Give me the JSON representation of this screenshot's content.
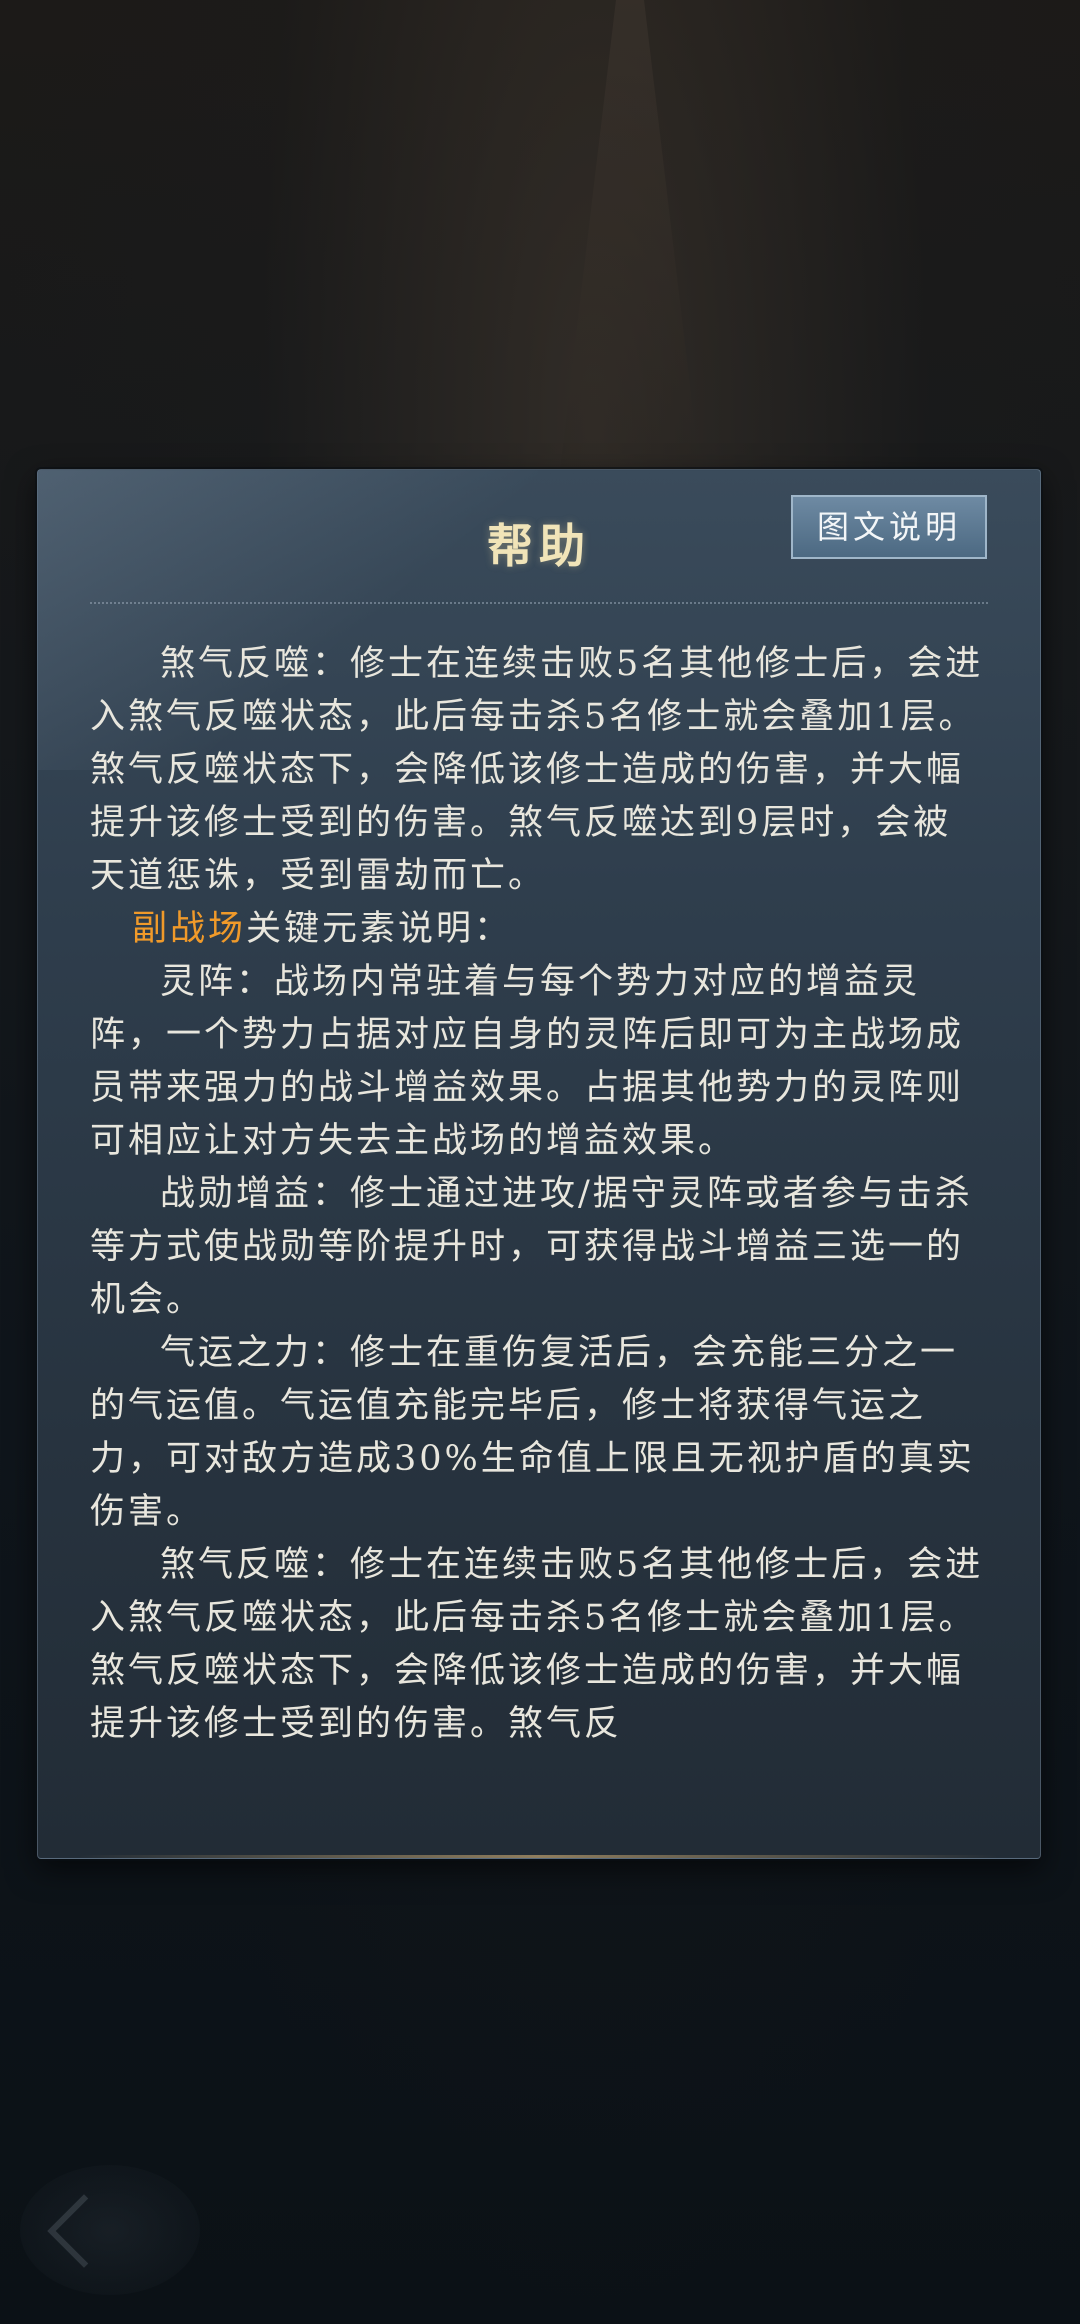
{
  "dialog": {
    "title": "帮助",
    "illustrated_button": "图文说明"
  },
  "content": {
    "p1": "煞气反噬：修士在连续击败5名其他修士后，会进入煞气反噬状态，此后每击杀5名修士就会叠加1层。煞气反噬状态下，会降低该修士造成的伤害，并大幅提升该修士受到的伤害。煞气反噬达到9层时，会被天道惩诛，受到雷劫而亡。",
    "subhead_highlight": "副战场",
    "subhead_rest": "关键元素说明：",
    "p2": "灵阵：战场内常驻着与每个势力对应的增益灵阵，一个势力占据对应自身的灵阵后即可为主战场成员带来强力的战斗增益效果。占据其他势力的灵阵则可相应让对方失去主战场的增益效果。",
    "p3": "战勋增益：修士通过进攻/据守灵阵或者参与击杀等方式使战勋等阶提升时，可获得战斗增益三选一的机会。",
    "p4": "气运之力：修士在重伤复活后，会充能三分之一的气运值。气运值充能完毕后，修士将获得气运之力，可对敌方造成30%生命值上限且无视护盾的真实伤害。",
    "p5": "煞气反噬：修士在连续击败5名其他修士后，会进入煞气反噬状态，此后每击杀5名修士就会叠加1层。煞气反噬状态下，会降低该修士造成的伤害，并大幅提升该修士受到的伤害。煞气反"
  },
  "colors": {
    "title": "#f1e4b8",
    "highlight": "#f09a2a",
    "body_text": "#e8e6dd"
  }
}
